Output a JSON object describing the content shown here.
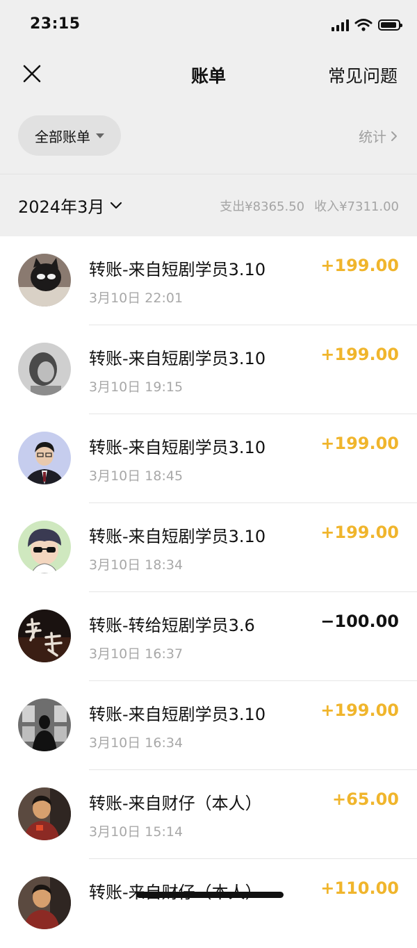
{
  "status_bar": {
    "time": "23:15"
  },
  "nav": {
    "title": "账单",
    "faq_label": "常见问题"
  },
  "filter": {
    "label": "全部账单",
    "stats_label": "统计"
  },
  "period": {
    "month": "2024年3月",
    "expense": "支出¥8365.50",
    "income": "收入¥7311.00"
  },
  "transactions": [
    {
      "title": "转账-来自短剧学员3.10",
      "time": "3月10日 22:01",
      "amount": "+199.00",
      "type": "income"
    },
    {
      "title": "转账-来自短剧学员3.10",
      "time": "3月10日 19:15",
      "amount": "+199.00",
      "type": "income"
    },
    {
      "title": "转账-来自短剧学员3.10",
      "time": "3月10日 18:45",
      "amount": "+199.00",
      "type": "income"
    },
    {
      "title": "转账-来自短剧学员3.10",
      "time": "3月10日 18:34",
      "amount": "+199.00",
      "type": "income"
    },
    {
      "title": "转账-转给短剧学员3.6",
      "time": "3月10日 16:37",
      "amount": "−100.00",
      "type": "expense"
    },
    {
      "title": "转账-来自短剧学员3.10",
      "time": "3月10日 16:34",
      "amount": "+199.00",
      "type": "income"
    },
    {
      "title": "转账-来自财仔（本人）",
      "time": "3月10日 15:14",
      "amount": "+65.00",
      "type": "income"
    },
    {
      "title": "转账-来自财仔（本人）",
      "time": "",
      "amount": "+110.00",
      "type": "income"
    }
  ],
  "colors": {
    "income": "#f0b52c",
    "expense": "#111111",
    "header_bg": "#efefef"
  }
}
